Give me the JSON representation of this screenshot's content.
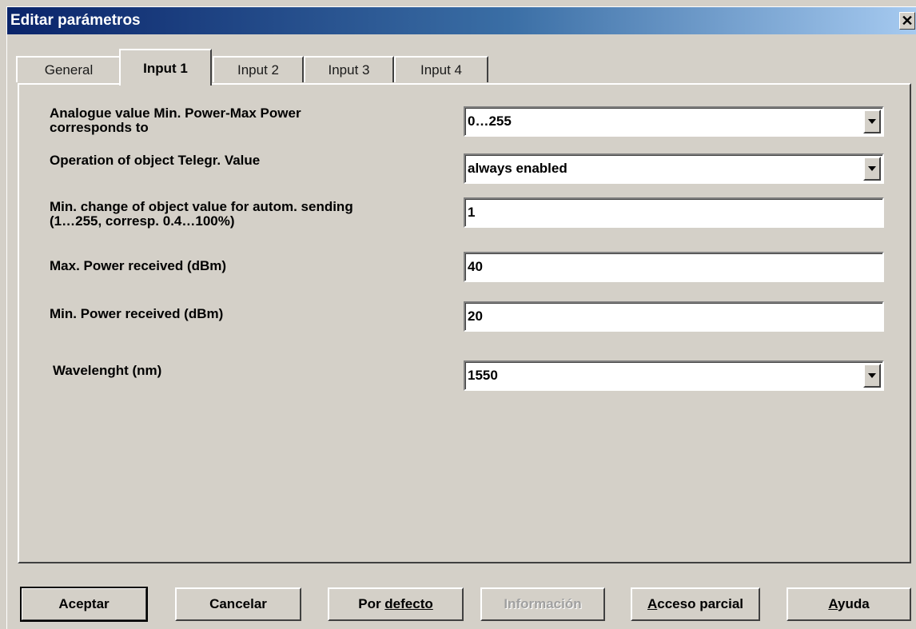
{
  "window": {
    "title": "Editar parámetros",
    "close_glyph": "✕"
  },
  "tabs": [
    {
      "label": "General",
      "active": false
    },
    {
      "label": "Input 1",
      "active": true
    },
    {
      "label": "Input 2",
      "active": false
    },
    {
      "label": "Input 3",
      "active": false
    },
    {
      "label": "Input 4",
      "active": false
    }
  ],
  "params": {
    "analogue_range": {
      "label": "Analogue value Min. Power-Max Power\ncorresponds to",
      "value": "0…255"
    },
    "telegr_operation": {
      "label": "Operation of object Telegr. Value",
      "value": "always enabled"
    },
    "min_change": {
      "label": "Min. change of object value for autom. sending\n(1…255, corresp. 0.4…100%)",
      "value": "1"
    },
    "max_power": {
      "label": "Max. Power received (dBm)",
      "value": "40"
    },
    "min_power": {
      "label": "Min. Power received (dBm)",
      "value": "20"
    },
    "wavelength": {
      "label": "Wavelenght (nm)",
      "value": "1550"
    }
  },
  "buttons": {
    "accept": {
      "label": "Aceptar"
    },
    "cancel": {
      "label": "Cancelar"
    },
    "defaults": {
      "label_pre": "Por ",
      "label_underlined": "defecto"
    },
    "info": {
      "label": "Información",
      "enabled": false
    },
    "partial_access": {
      "label_underlined": "A",
      "label_post": "cceso parcial"
    },
    "help": {
      "label_underlined": "A",
      "label_post": "yuda"
    }
  }
}
